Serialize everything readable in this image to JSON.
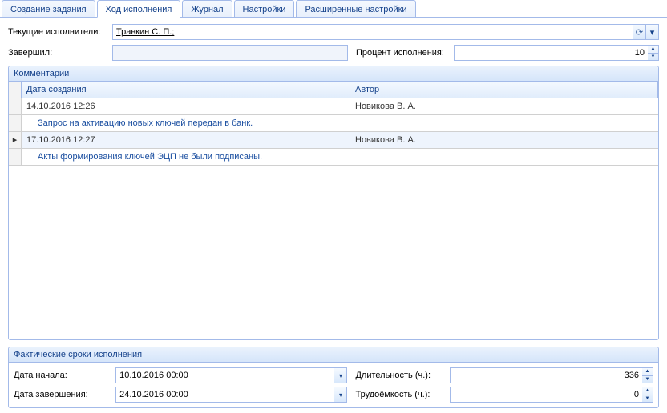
{
  "tabs": [
    {
      "label": "Создание задания"
    },
    {
      "label": "Ход исполнения"
    },
    {
      "label": "Журнал"
    },
    {
      "label": "Настройки"
    },
    {
      "label": "Расширенные настройки"
    }
  ],
  "activeTab": 1,
  "fields": {
    "executors_label": "Текущие исполнители:",
    "executors_value": "Травкин С. П.;",
    "completed_label": "Завершил:",
    "completed_value": "",
    "percent_label": "Процент исполнения:",
    "percent_value": "10"
  },
  "comments": {
    "title": "Комментарии",
    "col_date": "Дата создания",
    "col_author": "Автор",
    "rows": [
      {
        "date": "14.10.2016 12:26",
        "author": "Новикова В. А.",
        "text": "Запрос на активацию новых ключей передан в банк."
      },
      {
        "date": "17.10.2016 12:27",
        "author": "Новикова В. А.",
        "text": "Акты формирования ключей ЭЦП не были подписаны."
      }
    ],
    "selected_index": 1
  },
  "facts": {
    "title": "Фактические сроки исполнения",
    "start_label": "Дата начала:",
    "start_value": "10.10.2016 00:00",
    "end_label": "Дата завершения:",
    "end_value": "24.10.2016 00:00",
    "duration_label": "Длительность (ч.):",
    "duration_value": "336",
    "effort_label": "Трудоёмкость (ч.):",
    "effort_value": "0"
  },
  "icons": {
    "refresh": "⟳",
    "dropdown_arrow": "▾",
    "row_marker": "▸",
    "spin_up": "▲",
    "spin_down": "▼"
  }
}
